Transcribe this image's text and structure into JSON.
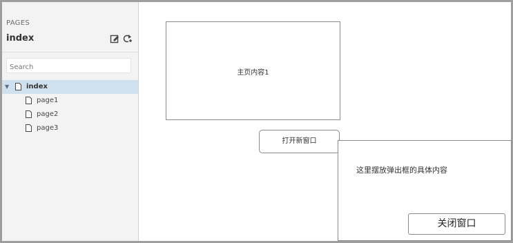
{
  "sidebar": {
    "heading": "PAGES",
    "current_page": "index",
    "icons": [
      "edit-page-icon",
      "add-page-icon"
    ],
    "search": {
      "placeholder": "Search"
    },
    "tree": [
      {
        "label": "index",
        "selected": true,
        "expanded": true
      },
      {
        "label": "page1"
      },
      {
        "label": "page2"
      },
      {
        "label": "page3"
      }
    ]
  },
  "canvas": {
    "main_box_text": "主页内容1",
    "open_button_label": "打开新窗口",
    "popup": {
      "content_text": "这里摆放弹出框的具体内容",
      "close_button_label": "关闭窗口"
    }
  }
}
